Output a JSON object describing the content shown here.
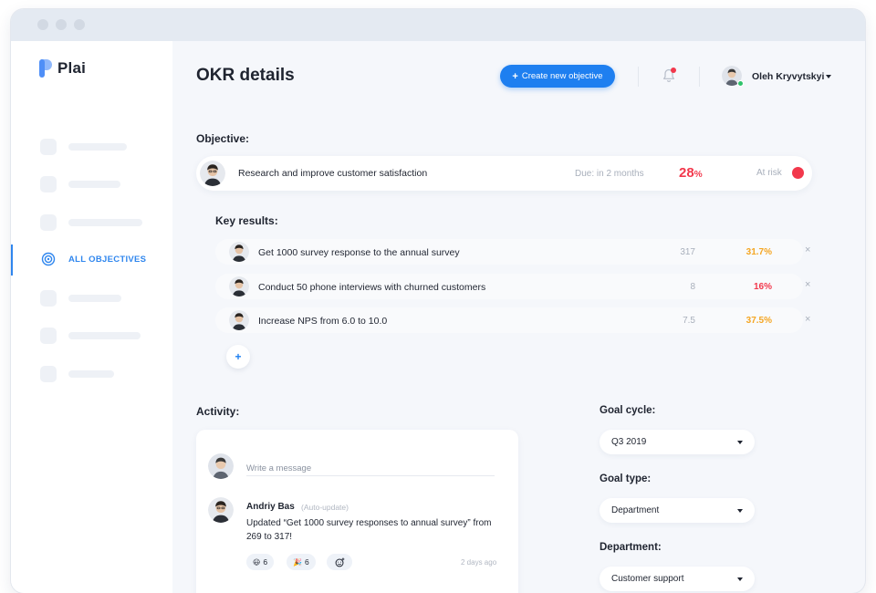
{
  "app": {
    "name": "Plai"
  },
  "sidebar": {
    "active_label": "ALL OBJECTIVES"
  },
  "header": {
    "title": "OKR details",
    "create_button": "Create new objective",
    "user_name": "Oleh Kryvytskyi"
  },
  "objective": {
    "section_label": "Objective:",
    "text": "Research and improve customer satisfaction",
    "due": "Due: in 2 months",
    "progress_value": "28",
    "progress_unit": "%",
    "status": "At risk",
    "status_color": "#f2384c"
  },
  "key_results": {
    "section_label": "Key results:",
    "items": [
      {
        "text": "Get 1000 survey response to the annual survey",
        "value": "317",
        "percent": "31.7%",
        "color": "#f5a623"
      },
      {
        "text": "Conduct 50 phone interviews with churned customers",
        "value": "8",
        "percent": "16%",
        "color": "#f2384c"
      },
      {
        "text": "Increase NPS from 6.0 to 10.0",
        "value": "7.5",
        "percent": "37.5%",
        "color": "#f5a623"
      }
    ],
    "remove_symbol": "×",
    "add_symbol": "+"
  },
  "activity": {
    "section_label": "Activity:",
    "message_placeholder": "Write a message",
    "entry": {
      "author": "Andriy Bas",
      "tag": "(Auto-update)",
      "text": "Updated “Get 1000 survey responses to annual survey” from 269 to 317!",
      "time": "2 days ago",
      "reactions": [
        {
          "emoji": "😃",
          "count": "6"
        },
        {
          "emoji": "🎉",
          "count": "6"
        }
      ]
    }
  },
  "settings": {
    "goal_cycle_label": "Goal cycle:",
    "goal_cycle_value": "Q3 2019",
    "goal_type_label": "Goal type:",
    "goal_type_value": "Department",
    "department_label": "Department:",
    "department_value": "Customer support"
  },
  "colors": {
    "accent": "#1e7ff0",
    "danger": "#f2384c",
    "warning": "#f5a623"
  }
}
